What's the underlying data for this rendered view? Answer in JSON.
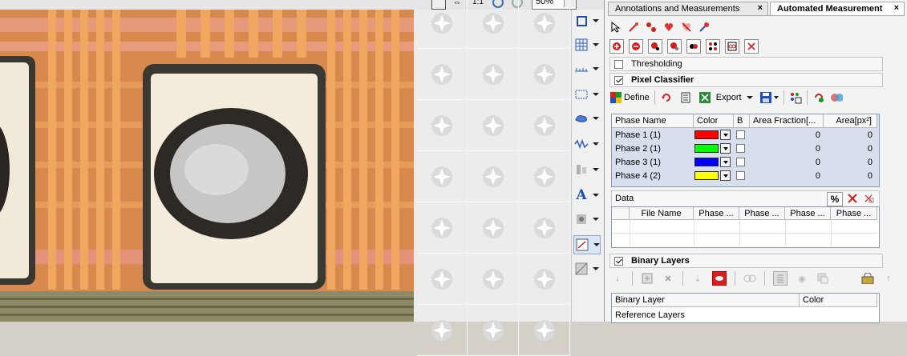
{
  "zoom": {
    "value": "50%"
  },
  "tabs": [
    {
      "label": "Annotations and Measurements",
      "close": "×"
    },
    {
      "label": "Automated Measurement",
      "close": "×"
    }
  ],
  "sections": {
    "thresholding": {
      "label": "Thresholding",
      "checked": false
    },
    "pixel_classifier": {
      "label": "Pixel Classifier",
      "checked": true
    },
    "binary_layers": {
      "label": "Binary Layers",
      "checked": true
    }
  },
  "pc_toolbar": {
    "define_label": "Define",
    "export_label": "Export"
  },
  "phase_table": {
    "headers": [
      "Phase Name",
      "Color",
      "B",
      "Area Fraction[...",
      "Area[px²]"
    ],
    "rows": [
      {
        "name": "Phase 1 (1)",
        "color": "#ff0000",
        "fraction": "0",
        "area": "0"
      },
      {
        "name": "Phase 2 (1)",
        "color": "#00ff00",
        "fraction": "0",
        "area": "0"
      },
      {
        "name": "Phase 3 (1)",
        "color": "#0000ff",
        "fraction": "0",
        "area": "0"
      },
      {
        "name": "Phase 4 (2)",
        "color": "#ffff00",
        "fraction": "0",
        "area": "0"
      }
    ]
  },
  "data_section": {
    "label": "Data",
    "percent": "%",
    "headers": [
      "File Name",
      "Phase ...",
      "Phase ...",
      "Phase ...",
      "Phase ..."
    ]
  },
  "binary_table": {
    "headers": [
      "Binary Layer",
      "Color"
    ],
    "rows": [
      "Reference Layers"
    ]
  },
  "colors": {
    "accent_red": "#d81e1e",
    "table_blue": "#d6dfeb"
  }
}
